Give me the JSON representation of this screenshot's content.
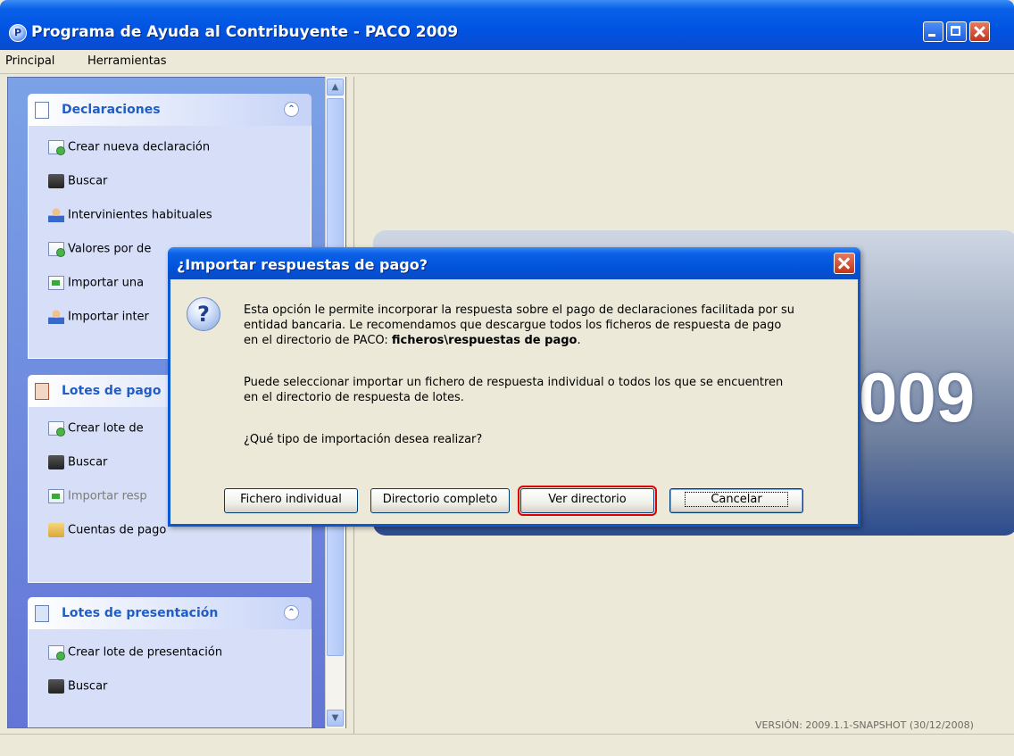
{
  "window": {
    "title": "Programa de Ayuda al Contribuyente - PACO 2009",
    "app_icon": "P"
  },
  "menu": [
    "Principal",
    "Herramientas"
  ],
  "sidebar": {
    "groups": [
      {
        "title": "Declaraciones",
        "items": [
          {
            "label": "Crear nueva declaración",
            "icon": "new-document-icon"
          },
          {
            "label": "Buscar",
            "icon": "binoculars-icon"
          },
          {
            "label": "Intervinientes habituales",
            "icon": "user-icon"
          },
          {
            "label": "Valores por de",
            "icon": "document-icon"
          },
          {
            "label": "Importar una",
            "icon": "import-icon"
          },
          {
            "label": "Importar inter",
            "icon": "user-icon"
          }
        ]
      },
      {
        "title": "Lotes de pago",
        "items": [
          {
            "label": "Crear lote de",
            "icon": "new-document-icon"
          },
          {
            "label": "Buscar",
            "icon": "binoculars-icon"
          },
          {
            "label": "Importar resp",
            "icon": "import-icon",
            "disabled": true
          },
          {
            "label": "Cuentas de pago",
            "icon": "folder-users-icon"
          }
        ]
      },
      {
        "title": "Lotes de presentación",
        "items": [
          {
            "label": "Crear lote de presentación",
            "icon": "new-document-icon"
          },
          {
            "label": "Buscar",
            "icon": "binoculars-icon"
          }
        ]
      }
    ]
  },
  "banner": {
    "number": "009"
  },
  "version": "VERSIÓN: 2009.1.1-SNAPSHOT (30/12/2008)",
  "dialog": {
    "title": "¿Importar respuestas de pago?",
    "icon": "question-icon",
    "para1_line1": "Esta opción le permite incorporar la respuesta sobre el pago de declaraciones facilitada por su",
    "para1_line2": "entidad bancaria. Le recomendamos que descargue todos los ficheros de respuesta de pago",
    "para1_line3_prefix": "en el directorio de PACO: ",
    "para1_line3_bold": "ficheros\\respuestas de pago",
    "para1_line3_suffix": ".",
    "para2_line1": "Puede seleccionar importar un fichero de respuesta individual o todos los que se encuentren",
    "para2_line2": "en el directorio de respuesta de lotes.",
    "question": "¿Qué tipo de importación desea realizar?",
    "buttons": {
      "individual": "Fichero individual",
      "completo": "Directorio completo",
      "ver": "Ver directorio",
      "cancelar": "Cancelar"
    }
  }
}
